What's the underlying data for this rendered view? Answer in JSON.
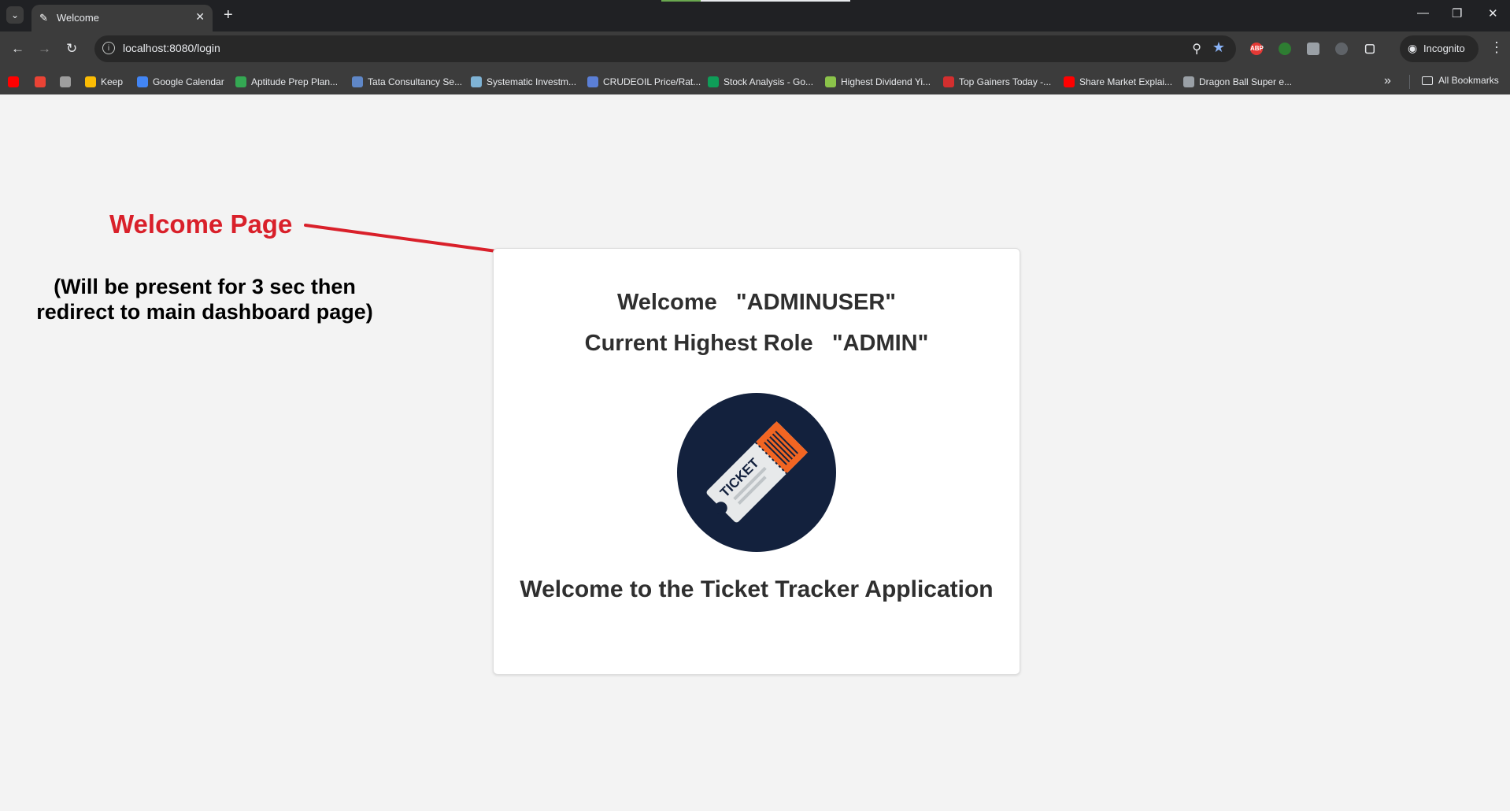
{
  "browser": {
    "tab_title": "Welcome",
    "url": "localhost:8080/login",
    "incognito_label": "Incognito",
    "bookmarks": [
      {
        "label": "",
        "icon": "youtube-icon",
        "color": "#ff0000"
      },
      {
        "label": "",
        "icon": "gmail-icon",
        "color": "#ea4335"
      },
      {
        "label": "",
        "icon": "folder-app-icon",
        "color": "#9e9e9e"
      },
      {
        "label": "Keep",
        "icon": "keep-icon",
        "color": "#fbbc04"
      },
      {
        "label": "Google Calendar",
        "icon": "calendar-icon",
        "color": "#4285f4"
      },
      {
        "label": "Aptitude Prep Plan...",
        "icon": "aptitude-icon",
        "color": "#34a853"
      },
      {
        "label": "Tata Consultancy Se...",
        "icon": "tcs-icon",
        "color": "#5f87c7"
      },
      {
        "label": "Systematic Investm...",
        "icon": "sip-icon",
        "color": "#7fb3d5"
      },
      {
        "label": "CRUDEOIL Price/Rat...",
        "icon": "crude-icon",
        "color": "#5b7fd6"
      },
      {
        "label": "Stock Analysis - Go...",
        "icon": "sheets-icon",
        "color": "#0f9d58"
      },
      {
        "label": "Highest Dividend Yi...",
        "icon": "chart-bars-icon",
        "color": "#8bc34a"
      },
      {
        "label": "Top Gainers Today -...",
        "icon": "et-icon",
        "color": "#d32f2f"
      },
      {
        "label": "Share Market Explai...",
        "icon": "youtube-icon",
        "color": "#ff0000"
      },
      {
        "label": "Dragon Ball Super e...",
        "icon": "globe-icon",
        "color": "#9aa0a6"
      }
    ],
    "all_bookmarks_label": "All Bookmarks"
  },
  "annotation": {
    "title": "Welcome Page",
    "note": "(Will be present for 3 sec then redirect to main dashboard page)",
    "color": "#d9202a"
  },
  "card": {
    "welcome_line": "Welcome   \"ADMINUSER\"",
    "role_line": "Current Highest Role   \"ADMIN\"",
    "logo_text": "TICKET",
    "footer": "Welcome to the Ticket Tracker Application"
  },
  "colors": {
    "logo_circle": "#13213d",
    "ticket_orange": "#f26522",
    "page_bg": "#f3f3f3"
  }
}
